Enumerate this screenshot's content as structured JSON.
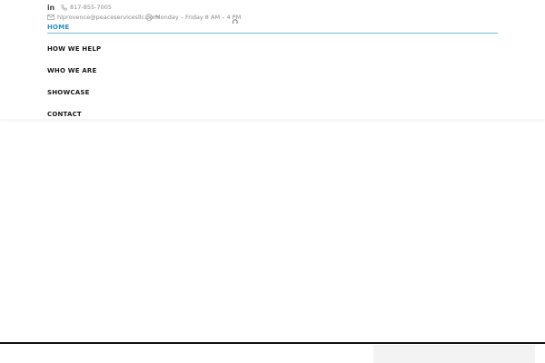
{
  "topbar": {
    "linkedin_label": "in",
    "phone": "817-855-7005",
    "email": "hlprovence@peaceservicesllc.com",
    "hours": "Monday – Friday 8 AM – 4 PM"
  },
  "nav": {
    "items": [
      {
        "label": "HOME",
        "active": true
      },
      {
        "label": "HOW WE HELP",
        "active": false
      },
      {
        "label": "WHO WE ARE",
        "active": false
      },
      {
        "label": "SHOWCASE",
        "active": false
      },
      {
        "label": "CONTACT",
        "active": false
      }
    ]
  },
  "colors": {
    "accent": "#2a8fbd",
    "text": "#1a1a1a",
    "muted": "#8a8a8a"
  },
  "icons": {
    "linkedin": "linkedin-icon",
    "phone": "phone-icon",
    "email": "email-icon",
    "clock": "clock-icon",
    "search": "search-icon"
  }
}
